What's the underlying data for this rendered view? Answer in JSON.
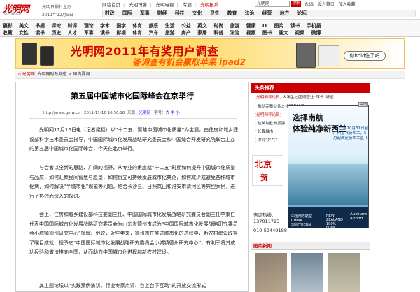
{
  "header": {
    "logo": "光明网",
    "logo_sub": "GMW.cn",
    "slogan": "光明日报社主办",
    "date": "2011年12月5日",
    "top_links": [
      "网站首页",
      "光明博客",
      "光明电视",
      "专题",
      "光明报系"
    ],
    "search_value": "光明网",
    "search_button": "搜索",
    "utility_links": [
      "RSS",
      "设为首页",
      "加入收藏"
    ],
    "nav_primary": [
      "时政",
      "国际",
      "军事",
      "财经",
      "科技",
      "文化",
      "卫生",
      "教育",
      "法治",
      "经营",
      "地方",
      "论坛"
    ]
  },
  "nav": {
    "row1": [
      "摄影",
      "美文",
      "书摘",
      "评论",
      "时评",
      "理论",
      "学术",
      "国学",
      "体育",
      "娱乐",
      "生活",
      "公益",
      "英文",
      "时尚",
      "旅游",
      "健康",
      "IT",
      "图片",
      "读书",
      "手机报"
    ],
    "row2": [
      "收藏",
      "女性",
      "读书",
      "历史",
      "人才",
      "军事",
      "读书",
      "影视",
      "体育",
      "汽车",
      "旅游",
      "房产",
      "家居",
      "科普",
      "法治",
      "视频",
      "图书",
      "亚太",
      "视频",
      "微博"
    ]
  },
  "banner": {
    "title": "光明网2011年有奖用户调查",
    "subtitle": "答调查有机会赢取苹果 ipad2",
    "tag": "你hold住了吗"
  },
  "breadcrumb": {
    "home": "光明网",
    "path": "光明网时政频道 > 国内要闻"
  },
  "article": {
    "title": "第五届中国城市化国际峰会在京举行",
    "source_url": "http://www.gmw.cn",
    "datetime": "2011-11-16 16:50:16",
    "source_label": "来源：",
    "source": "光明网",
    "font_label": "字号：",
    "font_sizes": "大 中 小",
    "paragraphs": [
      "光明网11月16日电（记者梁捷）以“十二五，聚焦中国城市化质量”为主题，由住房和城乡建设部科学技术委员会指导，中国国际城市化发展战略研究委员会和中国综合开发研究院联合主办的第五届中国城市化国际峰会，今天在北京举行。",
      "与会者以全新的思路、广阔的视野，从专业的角度就“十二五”时期如何提升中国城市化质量与品质，如何汇聚民间智慧与愿景，如何树立可持续发展城市化典范，如何减少或避免各种城市化病，如何解决“半城市化”现象等问题，结合长沙县、日照岚山和淮安市清河区等典型案例，进行了热烈而深入的探讨。",
      "会上，住房和城乡建设部科技委副主任、中国国际城市化发展战略研究委员会副主任李秉仁代表中国国际城市化发展战略研究委员会为山东省德州市成为“中国国际城市化发展战略研究委员会小城镇德州研究中心”授牌。他说，近些年来，德州市在推进城市化的进程中，新农村建设取得了瞩目成就，授予它“中国国际城市化发展战略研究委员会小城镇德州研究中心”，有利于将其成功经验和做法推向全国，从而助力中国城市化进程和新农村建设。",
      "其主题论坛以“实践案例演讲、行业专家点评、台上台下互动”的开放交流形式"
    ]
  },
  "sidebar": {
    "head": "头条推荐",
    "links": [
      {
        "tag": "[光明网评论员]",
        "text": "大学生社团调查让“浮云”听证"
      },
      {
        "tag": "[",
        "text": "推动完善公共文化服务体系"
      },
      {
        "tag": "[光明网评论员]",
        "text": ""
      },
      {
        "tag": "[",
        "text": "拉美与欧洲加强"
      },
      {
        "tag": "[",
        "text": "长春城市"
      }
    ],
    "extra_link": {
      "tag": "[",
      "text": "漂亮“乒乓”"
    },
    "img_text1": "北京",
    "img_text2": "贺",
    "phone_label": "咨询热线：",
    "phone1": "137011723",
    "phone2": "010-59449188",
    "pic_head": "图片新闻"
  },
  "ad": {
    "close": "关闭",
    "line1": "选择南航",
    "line2": "体验纯净新西兰",
    "line1_highlight": "南航",
    "promo": "2011年10月31日起广州直飞新西兰，5月起满足新西兰直飞",
    "footer1": "中国南方航空 CHINA SOUTHERN",
    "footer2": "NEW ZEALAND 100% PURE",
    "footer3": "Auckland Airport"
  },
  "colors": {
    "brand_red": "#cc0000",
    "ad_blue": "#102a4a"
  }
}
